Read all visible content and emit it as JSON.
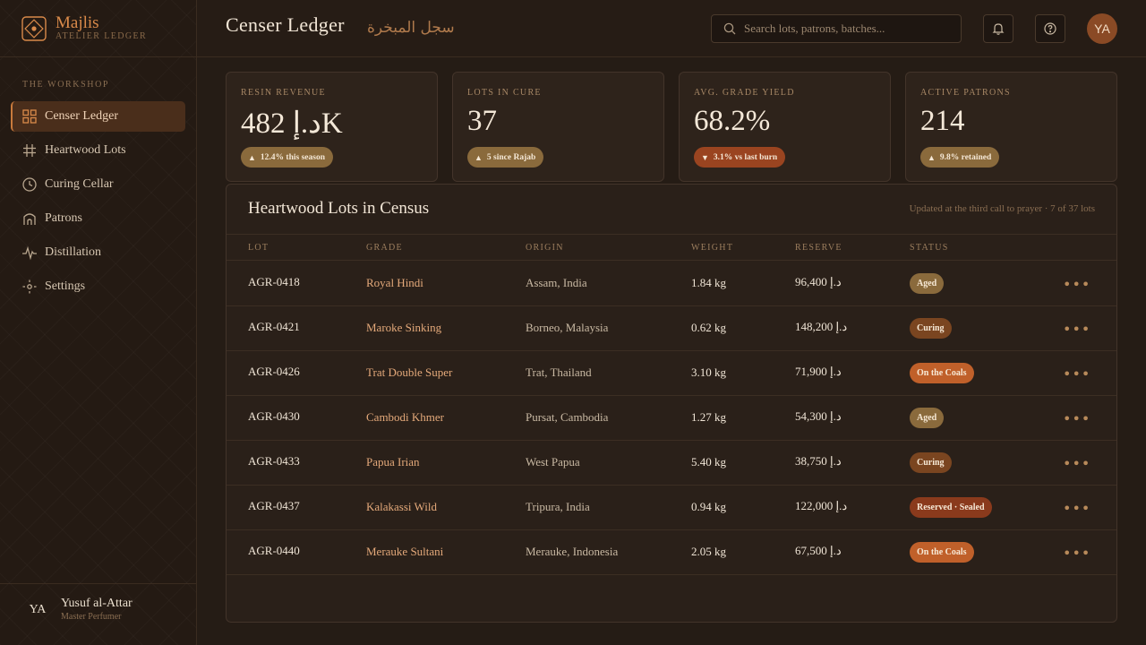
{
  "brand": {
    "name": "Majlis",
    "sub": "ATELIER LEDGER"
  },
  "sidebar": {
    "section_label": "THE WORKSHOP",
    "items": [
      {
        "label": "Censer Ledger",
        "icon": "grid-icon",
        "active": true
      },
      {
        "label": "Heartwood Lots",
        "icon": "lots-icon",
        "active": false
      },
      {
        "label": "Curing Cellar",
        "icon": "clock-icon",
        "active": false
      },
      {
        "label": "Patrons",
        "icon": "building-icon",
        "active": false
      },
      {
        "label": "Distillation",
        "icon": "pulse-icon",
        "active": false
      },
      {
        "label": "Settings",
        "icon": "gear-icon",
        "active": false
      }
    ],
    "user": {
      "initials": "YA",
      "name": "Yusuf al-Attar",
      "role": "Master Perfumer"
    }
  },
  "header": {
    "title": "Censer Ledger",
    "title_ar": "سجل المبخرة",
    "search_placeholder": "Search lots, patrons, batches...",
    "avatar_initials": "YA"
  },
  "stats": [
    {
      "label": "RESIN REVENUE",
      "value": "482 د.إK",
      "badge": "12.4% this season",
      "trend": "up"
    },
    {
      "label": "LOTS IN CURE",
      "value": "37",
      "badge": "5 since Rajab",
      "trend": "up"
    },
    {
      "label": "AVG. GRADE YIELD",
      "value": "68.2%",
      "badge": "3.1% vs last burn",
      "trend": "down"
    },
    {
      "label": "ACTIVE PATRONS",
      "value": "214",
      "badge": "9.8% retained",
      "trend": "up"
    }
  ],
  "table": {
    "title": "Heartwood Lots in Census",
    "meta": "Updated at the third call to prayer · 7 of 37 lots",
    "columns": [
      "LOT",
      "GRADE",
      "ORIGIN",
      "WEIGHT",
      "RESERVE",
      "STATUS"
    ],
    "rows": [
      {
        "lot": "AGR-0418",
        "grade": "Royal Hindi",
        "origin": "Assam, India",
        "weight": "1.84 kg",
        "reserve": "96,400 د.إ",
        "status": "Aged"
      },
      {
        "lot": "AGR-0421",
        "grade": "Maroke Sinking",
        "origin": "Borneo, Malaysia",
        "weight": "0.62 kg",
        "reserve": "148,200 د.إ",
        "status": "Curing"
      },
      {
        "lot": "AGR-0426",
        "grade": "Trat Double Super",
        "origin": "Trat, Thailand",
        "weight": "3.10 kg",
        "reserve": "71,900 د.إ",
        "status": "On the Coals"
      },
      {
        "lot": "AGR-0430",
        "grade": "Cambodi Khmer",
        "origin": "Pursat, Cambodia",
        "weight": "1.27 kg",
        "reserve": "54,300 د.إ",
        "status": "Aged"
      },
      {
        "lot": "AGR-0433",
        "grade": "Papua Irian",
        "origin": "West Papua",
        "weight": "5.40 kg",
        "reserve": "38,750 د.إ",
        "status": "Curing"
      },
      {
        "lot": "AGR-0437",
        "grade": "Kalakassi Wild",
        "origin": "Tripura, India",
        "weight": "0.94 kg",
        "reserve": "122,000 د.إ",
        "status": "Reserved · Sealed"
      },
      {
        "lot": "AGR-0440",
        "grade": "Merauke Sultani",
        "origin": "Merauke, Indonesia",
        "weight": "2.05 kg",
        "reserve": "67,500 د.إ",
        "status": "On the Coals"
      }
    ]
  },
  "status_colors": {
    "Aged": "#8a6a3c",
    "Curing": "#7a4520",
    "On the Coals": "#c0602a",
    "Reserved · Sealed": "#8a3a1c"
  }
}
